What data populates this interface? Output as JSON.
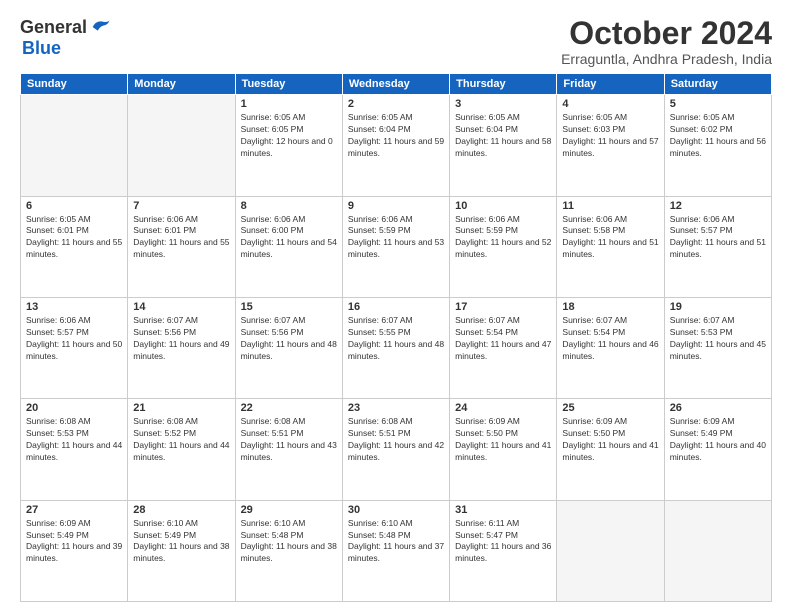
{
  "logo": {
    "general": "General",
    "blue": "Blue"
  },
  "title": "October 2024",
  "location": "Erraguntla, Andhra Pradesh, India",
  "days_header": [
    "Sunday",
    "Monday",
    "Tuesday",
    "Wednesday",
    "Thursday",
    "Friday",
    "Saturday"
  ],
  "weeks": [
    [
      {
        "day": "",
        "empty": true
      },
      {
        "day": "",
        "empty": true
      },
      {
        "day": "1",
        "sunrise": "Sunrise: 6:05 AM",
        "sunset": "Sunset: 6:05 PM",
        "daylight": "Daylight: 12 hours and 0 minutes."
      },
      {
        "day": "2",
        "sunrise": "Sunrise: 6:05 AM",
        "sunset": "Sunset: 6:04 PM",
        "daylight": "Daylight: 11 hours and 59 minutes."
      },
      {
        "day": "3",
        "sunrise": "Sunrise: 6:05 AM",
        "sunset": "Sunset: 6:04 PM",
        "daylight": "Daylight: 11 hours and 58 minutes."
      },
      {
        "day": "4",
        "sunrise": "Sunrise: 6:05 AM",
        "sunset": "Sunset: 6:03 PM",
        "daylight": "Daylight: 11 hours and 57 minutes."
      },
      {
        "day": "5",
        "sunrise": "Sunrise: 6:05 AM",
        "sunset": "Sunset: 6:02 PM",
        "daylight": "Daylight: 11 hours and 56 minutes."
      }
    ],
    [
      {
        "day": "6",
        "sunrise": "Sunrise: 6:05 AM",
        "sunset": "Sunset: 6:01 PM",
        "daylight": "Daylight: 11 hours and 55 minutes."
      },
      {
        "day": "7",
        "sunrise": "Sunrise: 6:06 AM",
        "sunset": "Sunset: 6:01 PM",
        "daylight": "Daylight: 11 hours and 55 minutes."
      },
      {
        "day": "8",
        "sunrise": "Sunrise: 6:06 AM",
        "sunset": "Sunset: 6:00 PM",
        "daylight": "Daylight: 11 hours and 54 minutes."
      },
      {
        "day": "9",
        "sunrise": "Sunrise: 6:06 AM",
        "sunset": "Sunset: 5:59 PM",
        "daylight": "Daylight: 11 hours and 53 minutes."
      },
      {
        "day": "10",
        "sunrise": "Sunrise: 6:06 AM",
        "sunset": "Sunset: 5:59 PM",
        "daylight": "Daylight: 11 hours and 52 minutes."
      },
      {
        "day": "11",
        "sunrise": "Sunrise: 6:06 AM",
        "sunset": "Sunset: 5:58 PM",
        "daylight": "Daylight: 11 hours and 51 minutes."
      },
      {
        "day": "12",
        "sunrise": "Sunrise: 6:06 AM",
        "sunset": "Sunset: 5:57 PM",
        "daylight": "Daylight: 11 hours and 51 minutes."
      }
    ],
    [
      {
        "day": "13",
        "sunrise": "Sunrise: 6:06 AM",
        "sunset": "Sunset: 5:57 PM",
        "daylight": "Daylight: 11 hours and 50 minutes."
      },
      {
        "day": "14",
        "sunrise": "Sunrise: 6:07 AM",
        "sunset": "Sunset: 5:56 PM",
        "daylight": "Daylight: 11 hours and 49 minutes."
      },
      {
        "day": "15",
        "sunrise": "Sunrise: 6:07 AM",
        "sunset": "Sunset: 5:56 PM",
        "daylight": "Daylight: 11 hours and 48 minutes."
      },
      {
        "day": "16",
        "sunrise": "Sunrise: 6:07 AM",
        "sunset": "Sunset: 5:55 PM",
        "daylight": "Daylight: 11 hours and 48 minutes."
      },
      {
        "day": "17",
        "sunrise": "Sunrise: 6:07 AM",
        "sunset": "Sunset: 5:54 PM",
        "daylight": "Daylight: 11 hours and 47 minutes."
      },
      {
        "day": "18",
        "sunrise": "Sunrise: 6:07 AM",
        "sunset": "Sunset: 5:54 PM",
        "daylight": "Daylight: 11 hours and 46 minutes."
      },
      {
        "day": "19",
        "sunrise": "Sunrise: 6:07 AM",
        "sunset": "Sunset: 5:53 PM",
        "daylight": "Daylight: 11 hours and 45 minutes."
      }
    ],
    [
      {
        "day": "20",
        "sunrise": "Sunrise: 6:08 AM",
        "sunset": "Sunset: 5:53 PM",
        "daylight": "Daylight: 11 hours and 44 minutes."
      },
      {
        "day": "21",
        "sunrise": "Sunrise: 6:08 AM",
        "sunset": "Sunset: 5:52 PM",
        "daylight": "Daylight: 11 hours and 44 minutes."
      },
      {
        "day": "22",
        "sunrise": "Sunrise: 6:08 AM",
        "sunset": "Sunset: 5:51 PM",
        "daylight": "Daylight: 11 hours and 43 minutes."
      },
      {
        "day": "23",
        "sunrise": "Sunrise: 6:08 AM",
        "sunset": "Sunset: 5:51 PM",
        "daylight": "Daylight: 11 hours and 42 minutes."
      },
      {
        "day": "24",
        "sunrise": "Sunrise: 6:09 AM",
        "sunset": "Sunset: 5:50 PM",
        "daylight": "Daylight: 11 hours and 41 minutes."
      },
      {
        "day": "25",
        "sunrise": "Sunrise: 6:09 AM",
        "sunset": "Sunset: 5:50 PM",
        "daylight": "Daylight: 11 hours and 41 minutes."
      },
      {
        "day": "26",
        "sunrise": "Sunrise: 6:09 AM",
        "sunset": "Sunset: 5:49 PM",
        "daylight": "Daylight: 11 hours and 40 minutes."
      }
    ],
    [
      {
        "day": "27",
        "sunrise": "Sunrise: 6:09 AM",
        "sunset": "Sunset: 5:49 PM",
        "daylight": "Daylight: 11 hours and 39 minutes."
      },
      {
        "day": "28",
        "sunrise": "Sunrise: 6:10 AM",
        "sunset": "Sunset: 5:49 PM",
        "daylight": "Daylight: 11 hours and 38 minutes."
      },
      {
        "day": "29",
        "sunrise": "Sunrise: 6:10 AM",
        "sunset": "Sunset: 5:48 PM",
        "daylight": "Daylight: 11 hours and 38 minutes."
      },
      {
        "day": "30",
        "sunrise": "Sunrise: 6:10 AM",
        "sunset": "Sunset: 5:48 PM",
        "daylight": "Daylight: 11 hours and 37 minutes."
      },
      {
        "day": "31",
        "sunrise": "Sunrise: 6:11 AM",
        "sunset": "Sunset: 5:47 PM",
        "daylight": "Daylight: 11 hours and 36 minutes."
      },
      {
        "day": "",
        "empty": true
      },
      {
        "day": "",
        "empty": true
      }
    ]
  ]
}
